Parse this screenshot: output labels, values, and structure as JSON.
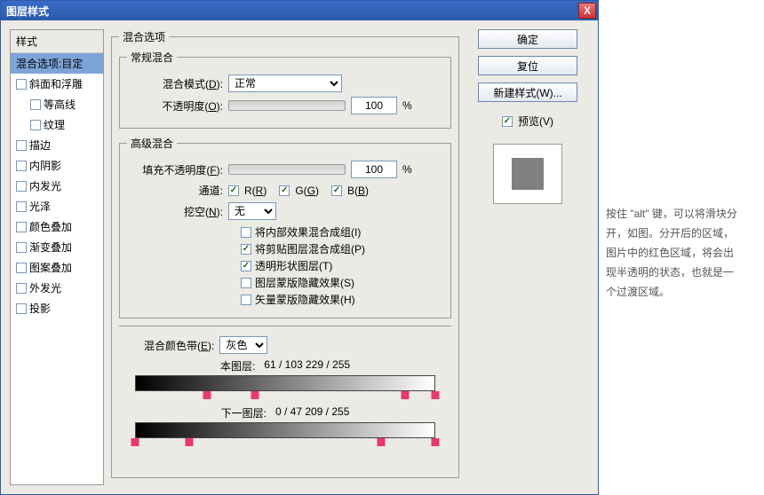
{
  "title": "图层样式",
  "close": "X",
  "sidebar": {
    "header": "样式",
    "items": [
      {
        "label": "混合选项:目定",
        "selected": true,
        "checkbox": false,
        "indent": false
      },
      {
        "label": "斜面和浮雕",
        "selected": false,
        "checkbox": true,
        "checked": false,
        "indent": false
      },
      {
        "label": "等高线",
        "selected": false,
        "checkbox": true,
        "checked": false,
        "indent": true
      },
      {
        "label": "纹理",
        "selected": false,
        "checkbox": true,
        "checked": false,
        "indent": true
      },
      {
        "label": "描边",
        "selected": false,
        "checkbox": true,
        "checked": false,
        "indent": false
      },
      {
        "label": "内阴影",
        "selected": false,
        "checkbox": true,
        "checked": false,
        "indent": false
      },
      {
        "label": "内发光",
        "selected": false,
        "checkbox": true,
        "checked": false,
        "indent": false
      },
      {
        "label": "光泽",
        "selected": false,
        "checkbox": true,
        "checked": false,
        "indent": false
      },
      {
        "label": "颜色叠加",
        "selected": false,
        "checkbox": true,
        "checked": false,
        "indent": false
      },
      {
        "label": "渐变叠加",
        "selected": false,
        "checkbox": true,
        "checked": false,
        "indent": false
      },
      {
        "label": "图案叠加",
        "selected": false,
        "checkbox": true,
        "checked": false,
        "indent": false
      },
      {
        "label": "外发光",
        "selected": false,
        "checkbox": true,
        "checked": false,
        "indent": false
      },
      {
        "label": "投影",
        "selected": false,
        "checkbox": true,
        "checked": false,
        "indent": false
      }
    ]
  },
  "main": {
    "blend_options_title": "混合选项",
    "general": {
      "title": "常规混合",
      "blend_mode_label": "混合模式(D):",
      "blend_mode_hot": "D",
      "blend_mode_value": "正常",
      "opacity_label": "不透明度(O):",
      "opacity_hot": "O",
      "opacity_value": "100",
      "percent": "%"
    },
    "advanced": {
      "title": "高级混合",
      "fill_label": "填充不透明度(F):",
      "fill_hot": "F",
      "fill_value": "100",
      "percent": "%",
      "channels_label": "通道:",
      "r": "R(R)",
      "r_hot": "R",
      "g": "G(G)",
      "g_hot": "G",
      "b": "B(B)",
      "b_hot": "B",
      "knockout_label": "挖空(N):",
      "knockout_hot": "N",
      "knockout_value": "无",
      "opts": [
        {
          "label": "将内部效果混合成组(I)",
          "checked": false
        },
        {
          "label": "将剪贴图层混合成组(P)",
          "checked": true
        },
        {
          "label": "透明形状图层(T)",
          "checked": true
        },
        {
          "label": "图层蒙版隐藏效果(S)",
          "checked": false
        },
        {
          "label": "矢量蒙版隐藏效果(H)",
          "checked": false
        }
      ]
    },
    "blendif": {
      "label": "混合颜色带(E):",
      "hot": "E",
      "value": "灰色",
      "this_label": "本图层:",
      "this_vals": [
        "61",
        "/",
        "103",
        "",
        "229",
        "/",
        "255"
      ],
      "under_label": "下一图层:",
      "under_vals": [
        "0",
        "/",
        "47",
        "",
        "209",
        "/",
        "255"
      ],
      "this_markers": [
        {
          "p": 24,
          "half": true,
          "side": "l"
        },
        {
          "p": 40,
          "half": true,
          "side": "r"
        },
        {
          "p": 90,
          "half": true,
          "side": "l"
        },
        {
          "p": 100,
          "half": true,
          "side": "r"
        }
      ],
      "under_markers": [
        {
          "p": 0,
          "half": true,
          "side": "l"
        },
        {
          "p": 18,
          "half": true,
          "side": "r"
        },
        {
          "p": 82,
          "half": true,
          "side": "l"
        },
        {
          "p": 100,
          "half": true,
          "side": "r"
        }
      ]
    }
  },
  "buttons": {
    "ok": "确定",
    "reset": "复位",
    "new_style": "新建样式(W)...",
    "preview_label": "预览(V)"
  },
  "caption": "按住 \"alt\" 键，可以将滑块分开，如图。分开后的区域，图片中的红色区域，将会出现半透明的状态，也就是一个过渡区域。"
}
